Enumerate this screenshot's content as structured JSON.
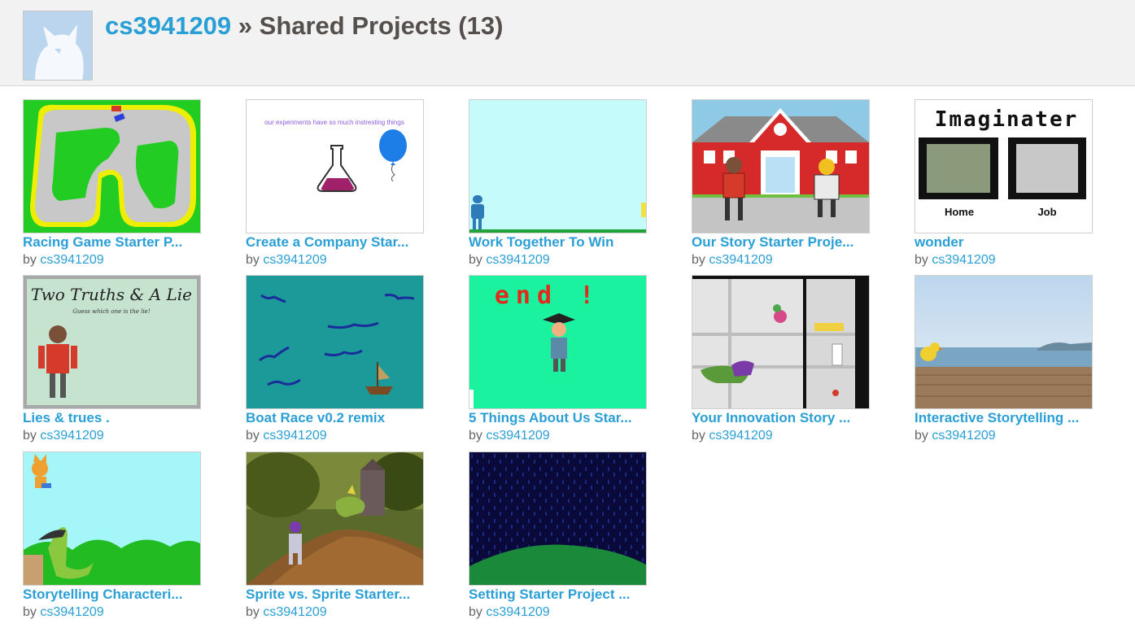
{
  "header": {
    "username": "cs3941209",
    "separator": " » ",
    "section": "Shared Projects (13)"
  },
  "by_label": "by",
  "projects": [
    {
      "title": "Racing Game Starter P...",
      "author": "cs3941209",
      "thumb": "racetrack"
    },
    {
      "title": "Create a Company Star...",
      "author": "cs3941209",
      "thumb": "experiment",
      "thumb_text": "our experiments have so much instresting things"
    },
    {
      "title": "Work Together To Win",
      "author": "cs3941209",
      "thumb": "cyan-stage"
    },
    {
      "title": "Our Story Starter Proje...",
      "author": "cs3941209",
      "thumb": "schoolhouse"
    },
    {
      "title": "wonder",
      "author": "cs3941209",
      "thumb": "imaginater",
      "thumb_text": "Imaginater",
      "thumb_labels": [
        "Home",
        "Job"
      ]
    },
    {
      "title": "Lies & trues .",
      "author": "cs3941209",
      "thumb": "two-truths",
      "thumb_text": "Two Truths & A Lie",
      "thumb_subtext": "Guess which one is the lie!"
    },
    {
      "title": "Boat Race v0.2 remix",
      "author": "cs3941209",
      "thumb": "boat-race"
    },
    {
      "title": "5 Things About Us Star...",
      "author": "cs3941209",
      "thumb": "end-screen",
      "thumb_text": "end !"
    },
    {
      "title": "Your Innovation Story ...",
      "author": "cs3941209",
      "thumb": "fridge"
    },
    {
      "title": "Interactive Storytelling ...",
      "author": "cs3941209",
      "thumb": "beach"
    },
    {
      "title": "Storytelling Characteri...",
      "author": "cs3941209",
      "thumb": "cat-dino"
    },
    {
      "title": "Sprite vs. Sprite Starter...",
      "author": "cs3941209",
      "thumb": "forest"
    },
    {
      "title": "Setting Starter Project ...",
      "author": "cs3941209",
      "thumb": "rain-night"
    }
  ],
  "colors": {
    "link": "#2a9fd6",
    "title": "#554f4d",
    "header_bg": "#f2f2f2"
  }
}
